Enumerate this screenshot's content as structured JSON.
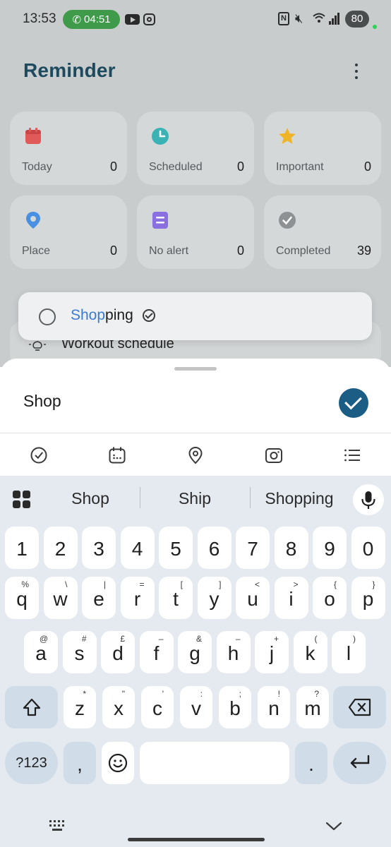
{
  "status_bar": {
    "time": "13:53",
    "call_timer": "04:51",
    "battery": "80"
  },
  "app": {
    "title": "Reminder"
  },
  "cards": [
    {
      "label": "Today",
      "count": "0",
      "icon": "calendar-icon",
      "color": "#e05a5a"
    },
    {
      "label": "Scheduled",
      "count": "0",
      "icon": "clock-icon",
      "color": "#3bb3b5"
    },
    {
      "label": "Important",
      "count": "0",
      "icon": "star-icon",
      "color": "#f0b429"
    },
    {
      "label": "Place",
      "count": "0",
      "icon": "location-pin-icon",
      "color": "#4a90e2"
    },
    {
      "label": "No alert",
      "count": "0",
      "icon": "note-icon",
      "color": "#8a6fe0"
    },
    {
      "label": "Completed",
      "count": "39",
      "icon": "check-circle-icon",
      "color": "#8d9193"
    }
  ],
  "list": {
    "dragging_item": {
      "prefix": "Shop",
      "rest": "ping"
    },
    "item_below": "Workout schedule"
  },
  "sheet": {
    "input_value": "Shop",
    "tools": [
      "check-circle-icon",
      "calendar-icon",
      "location-pin-icon",
      "camera-icon",
      "list-icon"
    ]
  },
  "keyboard": {
    "suggestions": [
      "Shop",
      "Ship",
      "Shopping"
    ],
    "row_numbers": [
      "1",
      "2",
      "3",
      "4",
      "5",
      "6",
      "7",
      "8",
      "9",
      "0"
    ],
    "row1": [
      {
        "k": "q",
        "s": "%"
      },
      {
        "k": "w",
        "s": "\\"
      },
      {
        "k": "e",
        "s": "|"
      },
      {
        "k": "r",
        "s": "="
      },
      {
        "k": "t",
        "s": "["
      },
      {
        "k": "y",
        "s": "]"
      },
      {
        "k": "u",
        "s": "<"
      },
      {
        "k": "i",
        "s": ">"
      },
      {
        "k": "o",
        "s": "{"
      },
      {
        "k": "p",
        "s": "}"
      }
    ],
    "row2": [
      {
        "k": "a",
        "s": "@"
      },
      {
        "k": "s",
        "s": "#"
      },
      {
        "k": "d",
        "s": "£"
      },
      {
        "k": "f",
        "s": "–"
      },
      {
        "k": "g",
        "s": "&"
      },
      {
        "k": "h",
        "s": "–"
      },
      {
        "k": "j",
        "s": "+"
      },
      {
        "k": "k",
        "s": "("
      },
      {
        "k": "l",
        "s": ")"
      }
    ],
    "row3": [
      {
        "k": "z",
        "s": "*"
      },
      {
        "k": "x",
        "s": "\""
      },
      {
        "k": "c",
        "s": "'"
      },
      {
        "k": "v",
        "s": ":"
      },
      {
        "k": "b",
        "s": ";"
      },
      {
        "k": "n",
        "s": "!"
      },
      {
        "k": "m",
        "s": "?"
      }
    ],
    "symbols_label": "?123",
    "comma": ",",
    "period": "."
  }
}
